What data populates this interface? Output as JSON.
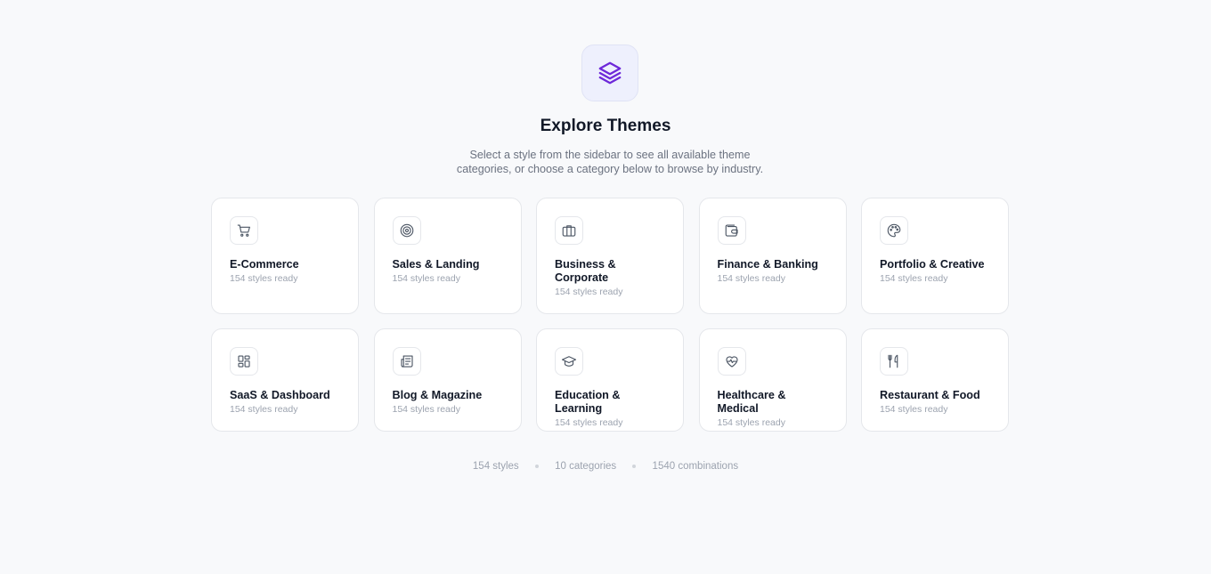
{
  "header": {
    "title": "Explore Themes",
    "subtitle_line1": "Select a style from the sidebar to see all available theme",
    "subtitle_line2": "categories, or choose a category below to browse by industry.",
    "icon": "layers-icon",
    "accent_color": "#6d28d9"
  },
  "categories": [
    {
      "name": "E-Commerce",
      "meta": "154 styles ready",
      "icon": "shopping-cart-icon"
    },
    {
      "name": "Sales & Landing",
      "meta": "154 styles ready",
      "icon": "target-icon"
    },
    {
      "name": "Business & Corporate",
      "meta": "154 styles ready",
      "icon": "briefcase-icon"
    },
    {
      "name": "Finance & Banking",
      "meta": "154 styles ready",
      "icon": "wallet-icon"
    },
    {
      "name": "Portfolio & Creative",
      "meta": "154 styles ready",
      "icon": "palette-icon"
    },
    {
      "name": "SaaS & Dashboard",
      "meta": "154 styles ready",
      "icon": "dashboard-icon"
    },
    {
      "name": "Blog & Magazine",
      "meta": "154 styles ready",
      "icon": "newspaper-icon"
    },
    {
      "name": "Education & Learning",
      "meta": "154 styles ready",
      "icon": "graduation-cap-icon"
    },
    {
      "name": "Healthcare & Medical",
      "meta": "154 styles ready",
      "icon": "heart-pulse-icon"
    },
    {
      "name": "Restaurant & Food",
      "meta": "154 styles ready",
      "icon": "utensils-icon"
    }
  ],
  "stats": {
    "styles": "154 styles",
    "categories": "10 categories",
    "combinations": "1540 combinations"
  }
}
